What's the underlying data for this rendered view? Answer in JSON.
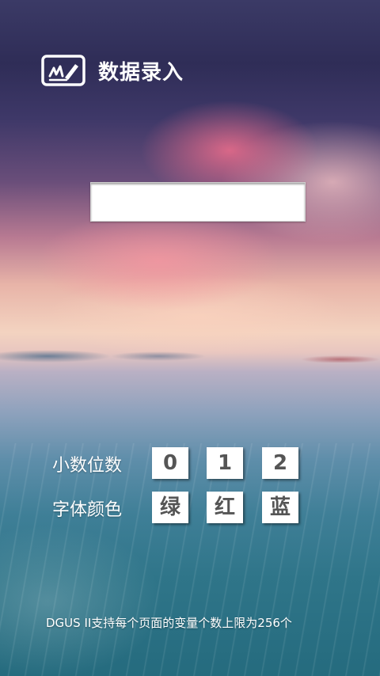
{
  "header": {
    "icon": "signature-screen-icon",
    "title": "数据录入"
  },
  "input": {
    "value": ""
  },
  "decimals": {
    "label": "小数位数",
    "options": [
      "0",
      "1",
      "2"
    ]
  },
  "font_color": {
    "label": "字体颜色",
    "options": [
      "绿",
      "红",
      "蓝"
    ]
  },
  "footer": {
    "note": "DGUS II支持每个页面的变量个数上限为256个"
  },
  "colors": {
    "button_bg": "#ffffff",
    "button_text": "#555555",
    "label_text": "#ffffff"
  }
}
